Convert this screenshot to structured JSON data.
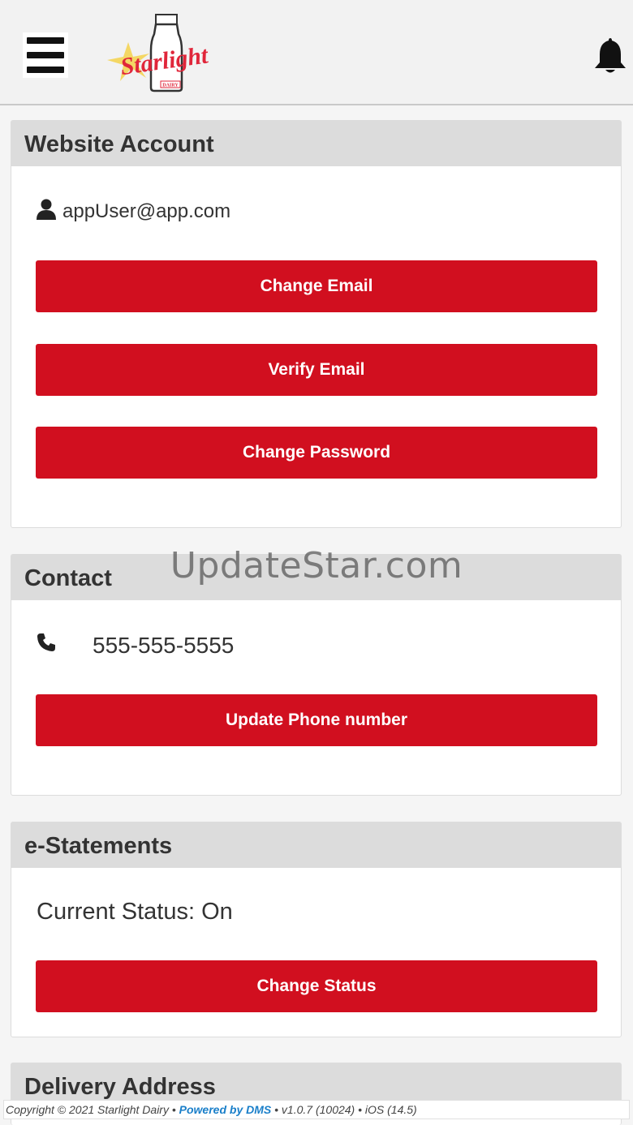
{
  "header": {
    "logo_text": "Starlight",
    "logo_subtext": "DAIRY",
    "colors": {
      "logo_red": "#e0263a",
      "logo_star": "#f5d24b"
    }
  },
  "watermark": "UpdateStar.com",
  "website_account": {
    "title": "Website Account",
    "email": "appUser@app.com",
    "change_email": "Change Email",
    "verify_email": "Verify Email",
    "change_password": "Change Password"
  },
  "contact": {
    "title": "Contact",
    "phone": "555-555-5555",
    "update_phone": "Update Phone number"
  },
  "estatements": {
    "title": "e-Statements",
    "status": "Current Status: On",
    "change_status": "Change Status"
  },
  "delivery": {
    "title": "Delivery Address"
  },
  "footer": {
    "copyright": "Copyright © 2021 Starlight Dairy •",
    "powered": "Powered by DMS",
    "version": "• v1.0.7 (10024) • iOS (14.5)"
  },
  "colors": {
    "button_red": "#d10f1f",
    "link_blue": "#1a7fc9"
  }
}
